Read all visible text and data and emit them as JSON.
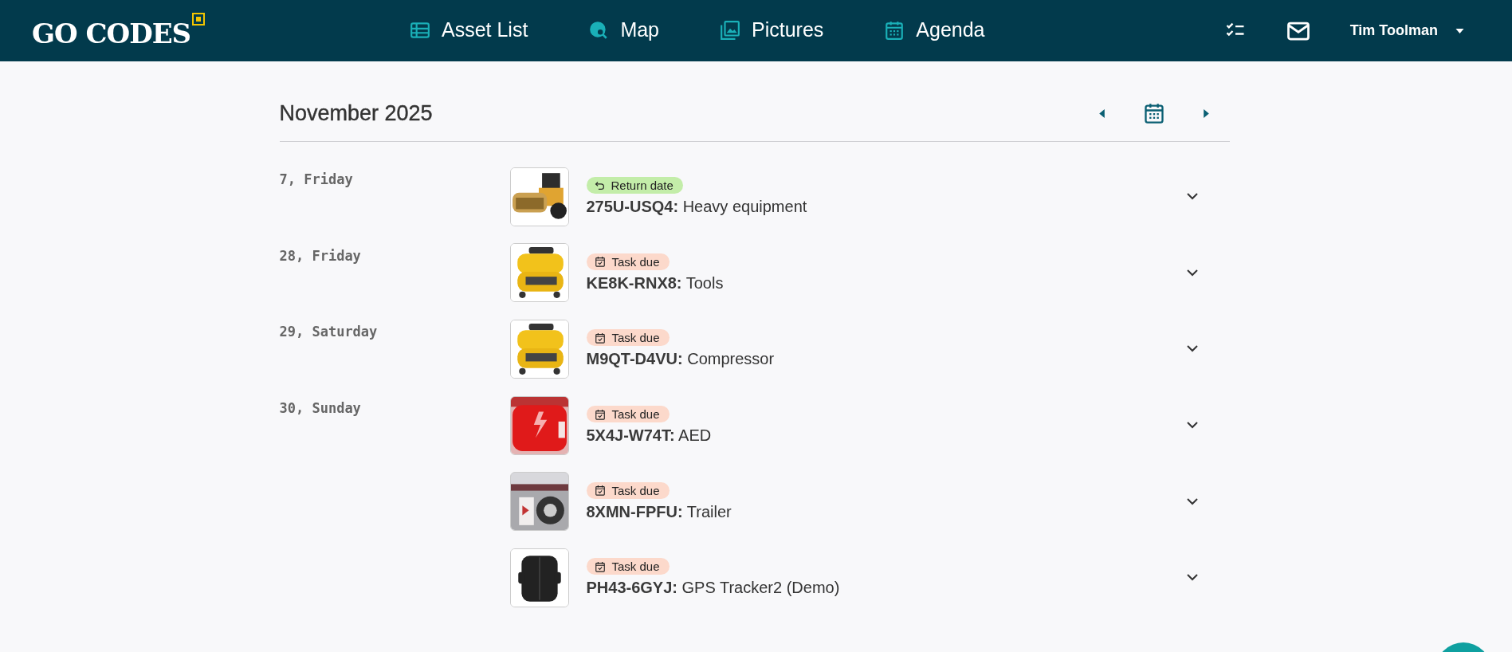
{
  "header": {
    "logo": "GO CODES",
    "nav": [
      {
        "label": "Asset List"
      },
      {
        "label": "Map"
      },
      {
        "label": "Pictures"
      },
      {
        "label": "Agenda"
      }
    ],
    "user": "Tim Toolman"
  },
  "calendar": {
    "title": "November 2025",
    "days": [
      {
        "date": "7, Friday",
        "items": [
          {
            "badge": {
              "kind": "return",
              "label": "Return date"
            },
            "code": "275U-USQ4:",
            "name": "Heavy equipment",
            "expanded": false
          }
        ]
      },
      {
        "date": "28, Friday",
        "items": [
          {
            "badge": {
              "kind": "task",
              "label": "Task due"
            },
            "code": "KE8K-RNX8:",
            "name": "Tools",
            "expanded": false
          }
        ]
      },
      {
        "date": "29, Saturday",
        "items": [
          {
            "badge": {
              "kind": "task",
              "label": "Task due"
            },
            "code": "M9QT-D4VU:",
            "name": "Compressor",
            "expanded": false
          }
        ]
      },
      {
        "date": "30, Sunday",
        "items": [
          {
            "badge": {
              "kind": "task",
              "label": "Task due"
            },
            "code": "5X4J-W74T:",
            "name": "AED",
            "expanded": false
          },
          {
            "badge": {
              "kind": "task",
              "label": "Task due"
            },
            "code": "8XMN-FPFU:",
            "name": "Trailer",
            "expanded": false
          },
          {
            "badge": {
              "kind": "task",
              "label": "Task due"
            },
            "code": "PH43-6GYJ:",
            "name": "GPS Tracker2 (Demo)",
            "expanded": false
          }
        ]
      }
    ]
  }
}
